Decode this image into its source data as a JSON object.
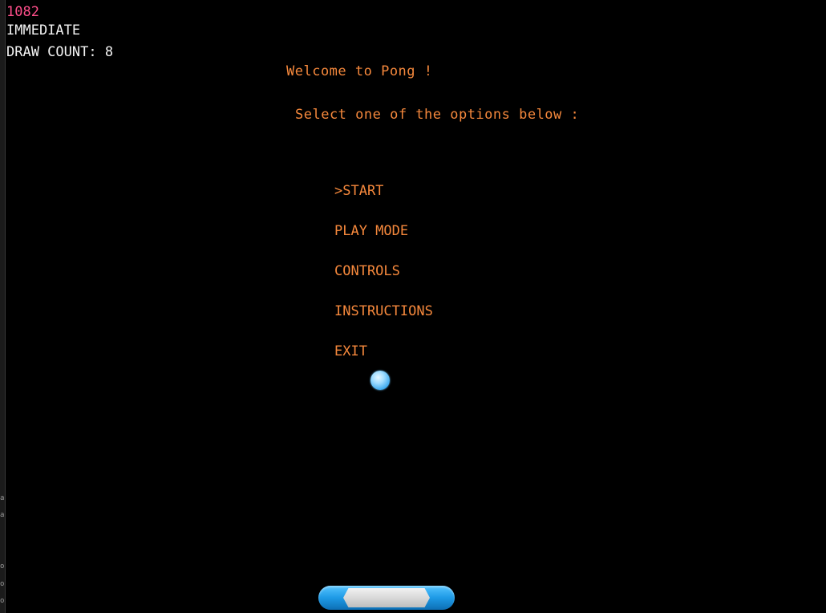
{
  "hud": {
    "fps": "1082",
    "render_mode": "IMMEDIATE",
    "draw_count": "DRAW COUNT: 8"
  },
  "menu": {
    "title": "Welcome to Pong !",
    "prompt": "Select one of the options below :",
    "items": [
      {
        "label": ">START",
        "selected": true
      },
      {
        "label": "PLAY MODE",
        "selected": false
      },
      {
        "label": "CONTROLS",
        "selected": false
      },
      {
        "label": "INSTRUCTIONS",
        "selected": false
      },
      {
        "label": "EXIT",
        "selected": false
      }
    ]
  },
  "left_edge_glyphs": [
    "a",
    "a",
    "o",
    "o",
    "o"
  ],
  "colors": {
    "background": "#000000",
    "fps_text": "#ff4f8b",
    "hud_text": "#f3f3f3",
    "menu_text": "#f5883c",
    "ball": "#6cc6ff",
    "paddle": "#1e9ae6"
  },
  "icons": {
    "ball": "ball-sprite",
    "paddle": "paddle-sprite"
  }
}
